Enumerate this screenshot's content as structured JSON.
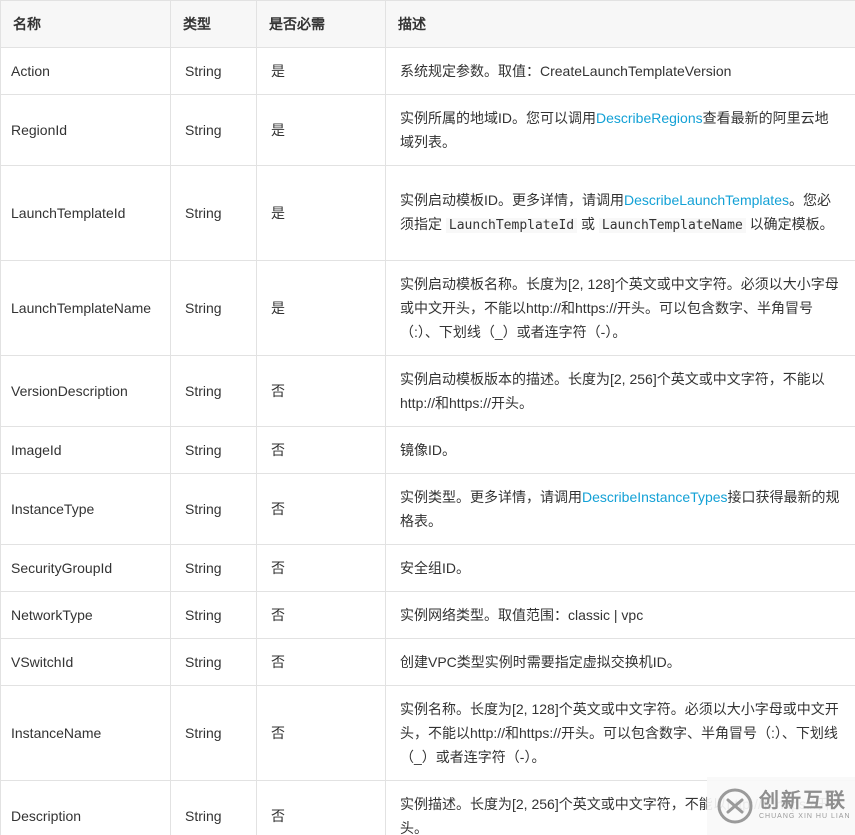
{
  "header": {
    "name": "名称",
    "type": "类型",
    "required": "是否必需",
    "description": "描述"
  },
  "rows": [
    {
      "name": "Action",
      "type": "String",
      "required": "是",
      "desc": [
        {
          "t": "系统规定参数。取值：CreateLaunchTemplateVersion"
        }
      ]
    },
    {
      "name": "RegionId",
      "type": "String",
      "required": "是",
      "desc": [
        {
          "t": "实例所属的地域ID。您可以调用"
        },
        {
          "t": "DescribeRegions",
          "link": true
        },
        {
          "t": "查看最新的阿里云地域列表。"
        }
      ]
    },
    {
      "name": "LaunchTemplateId",
      "type": "String",
      "required": "是",
      "desc": [
        {
          "t": "实例启动模板ID。更多详情，请调用"
        },
        {
          "t": "DescribeLaunchTemplates",
          "link": true
        },
        {
          "t": "。您必须指定 "
        },
        {
          "t": "LaunchTemplateId",
          "code": true
        },
        {
          "t": " 或 "
        },
        {
          "t": "LaunchTemplateName",
          "code": true
        },
        {
          "t": " 以确定模板。"
        }
      ]
    },
    {
      "name": "LaunchTemplateNa​me",
      "type": "String",
      "required": "是",
      "desc": [
        {
          "t": "实例启动模板名称。长度为[2, 128]个英文或中文字符。必须以大小字母或中文开头，不能以http://和https://开头。可以包含数字、半角冒号（:）、下划线（_）或者连字符（-）。"
        }
      ]
    },
    {
      "name": "VersionDescription",
      "type": "String",
      "required": "否",
      "desc": [
        {
          "t": "实例启动模板版本的描述。长度为[2, 256]个英文或中文字符，不能以http://和https://开头。"
        }
      ]
    },
    {
      "name": "ImageId",
      "type": "String",
      "required": "否",
      "desc": [
        {
          "t": "镜像ID。"
        }
      ]
    },
    {
      "name": "InstanceType",
      "type": "String",
      "required": "否",
      "desc": [
        {
          "t": "实例类型。更多详情，请调用"
        },
        {
          "t": "DescribeInstanceTypes",
          "link": true
        },
        {
          "t": "接口获得最新的规格表。"
        }
      ]
    },
    {
      "name": "SecurityGroupId",
      "type": "String",
      "required": "否",
      "desc": [
        {
          "t": "安全组ID。"
        }
      ]
    },
    {
      "name": "NetworkType",
      "type": "String",
      "required": "否",
      "desc": [
        {
          "t": "实例网络类型。取值范围：classic | vpc"
        }
      ]
    },
    {
      "name": "VSwitchId",
      "type": "String",
      "required": "否",
      "desc": [
        {
          "t": "创建VPC类型实例时需要指定虚拟交换机ID。"
        }
      ]
    },
    {
      "name": "InstanceName",
      "type": "String",
      "required": "否",
      "desc": [
        {
          "t": "实例名称。长度为[2, 128]个英文或中文字符。必须以大小字母或中文开头，不能以http://和https://开头。可以包含数字、半角冒号（:）、下划线（_）或者连字符（-）。"
        }
      ]
    },
    {
      "name": "Description",
      "type": "String",
      "required": "否",
      "desc": [
        {
          "t": "实例描述。长度为[2, 256]个英文或中文字符，不能以http://和https://开头。"
        }
      ]
    }
  ],
  "watermark": {
    "cn": "创新互联",
    "en": "CHUANG XIN HU LIAN"
  },
  "colors": {
    "link": "#13a1d6",
    "border": "#e2e2e2",
    "header_bg": "#f7f7f7"
  }
}
